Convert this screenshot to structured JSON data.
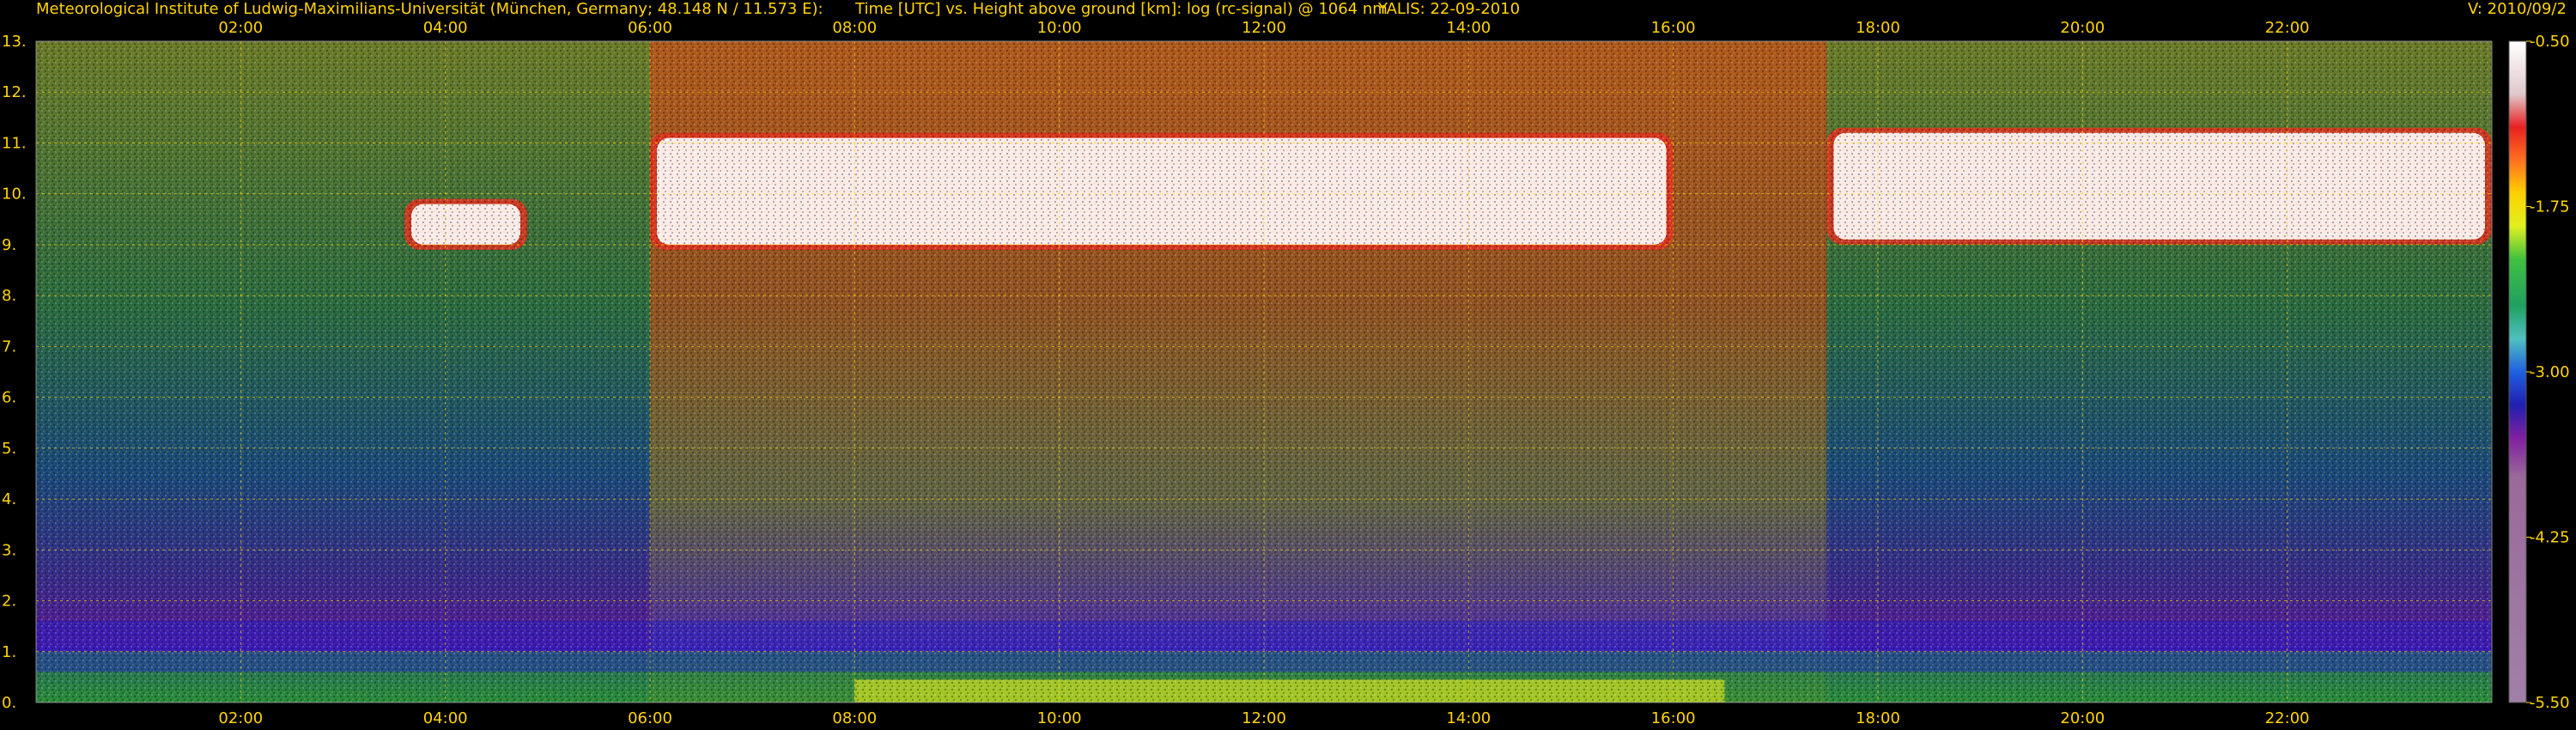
{
  "header": {
    "institute": "Meteorological Institute of Ludwig-Maximilians-Universität (München, Germany; 48.148 N / 11.573 E):",
    "description": "Time [UTC] vs. Height above ground [km]: log (rc-signal) @ 1064 nm",
    "instrument": "YALIS: 22-09-2010",
    "version": "V: 2010/09/2"
  },
  "colors": {
    "text": "#ffd400",
    "grid": "#ffd400",
    "background": "#000000"
  },
  "chart_data": {
    "type": "heatmap",
    "title": "Time [UTC] vs. Height above ground [km]: log (rc-signal) @ 1064 nm",
    "xlabel": "Time [UTC]",
    "ylabel": "Height above ground [km]",
    "x_ticks": [
      "02:00",
      "04:00",
      "06:00",
      "08:00",
      "10:00",
      "12:00",
      "14:00",
      "16:00",
      "18:00",
      "20:00",
      "22:00"
    ],
    "x_tick_hours": [
      2,
      4,
      6,
      8,
      10,
      12,
      14,
      16,
      18,
      20,
      22
    ],
    "xlim": [
      0,
      24
    ],
    "y_ticks": [
      "0.",
      "1.",
      "2.",
      "3.",
      "4.",
      "5.",
      "6.",
      "7.",
      "8.",
      "9.",
      "10.",
      "11.",
      "12.",
      "13."
    ],
    "ylim": [
      0,
      13
    ],
    "grid": true,
    "colorbar": {
      "range": [
        -5.5,
        -0.5
      ],
      "tick_labels": [
        "-0.50",
        "-1.75",
        "-3.00",
        "-4.25",
        "-5.50"
      ],
      "tick_values": [
        -0.5,
        -1.75,
        -3.0,
        -4.25,
        -5.5
      ],
      "position": "right"
    },
    "features": {
      "cirrus_layers": [
        {
          "start_h": 3.6,
          "end_h": 4.8,
          "base_km": 8.9,
          "top_km": 9.9
        },
        {
          "start_h": 6.0,
          "end_h": 16.0,
          "base_km": 8.9,
          "top_km": 11.2
        },
        {
          "start_h": 17.5,
          "end_h": 24.0,
          "base_km": 9.0,
          "top_km": 11.3
        }
      ],
      "boundary_layer_top_km": 1.0
    }
  }
}
